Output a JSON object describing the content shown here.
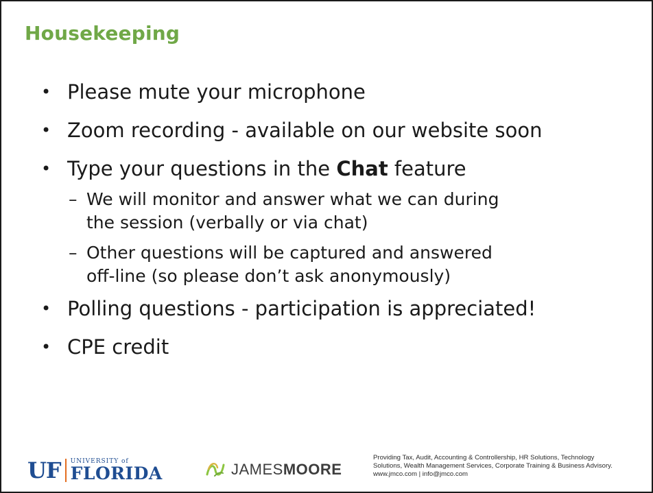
{
  "slide": {
    "title": "Housekeeping",
    "bullets": [
      {
        "text": "Please mute your microphone"
      },
      {
        "text": "Zoom recording - available on our website soon"
      },
      {
        "text_before": "Type your questions in the ",
        "text_bold": "Chat",
        "text_after": " feature"
      },
      {
        "text": "Polling questions - participation is appreciated!"
      },
      {
        "text": "CPE credit"
      }
    ],
    "sub_bullets": [
      {
        "line1": "We will monitor and answer what we can during",
        "line2": "the session (verbally or via chat)"
      },
      {
        "line1": "Other questions will be captured and answered",
        "line2": "off-line (so please don’t ask anonymously)"
      }
    ]
  },
  "footer": {
    "uf_logo": {
      "mark": "UF",
      "univ": "UNIVERSITY of",
      "florida": "FLORIDA"
    },
    "jm_logo": {
      "name_light": "JAMES",
      "name_bold": "MOORE",
      "icon": "jamesmoore-swirl-icon"
    },
    "tagline_line1": "Providing Tax, Audit, Accounting & Controllership, HR Solutions, Technology",
    "tagline_line2": "Solutions, Wealth Management Services, Corporate Training & Business Advisory.",
    "tagline_line3": "www.jmco.com  |  info@jmco.com"
  },
  "colors": {
    "title": "#70a847",
    "text": "#1a1a1a",
    "uf_blue": "#1f4d92",
    "uf_orange": "#e46d1f",
    "jm_green": "#8cc540",
    "jm_gold": "#d8b542"
  }
}
